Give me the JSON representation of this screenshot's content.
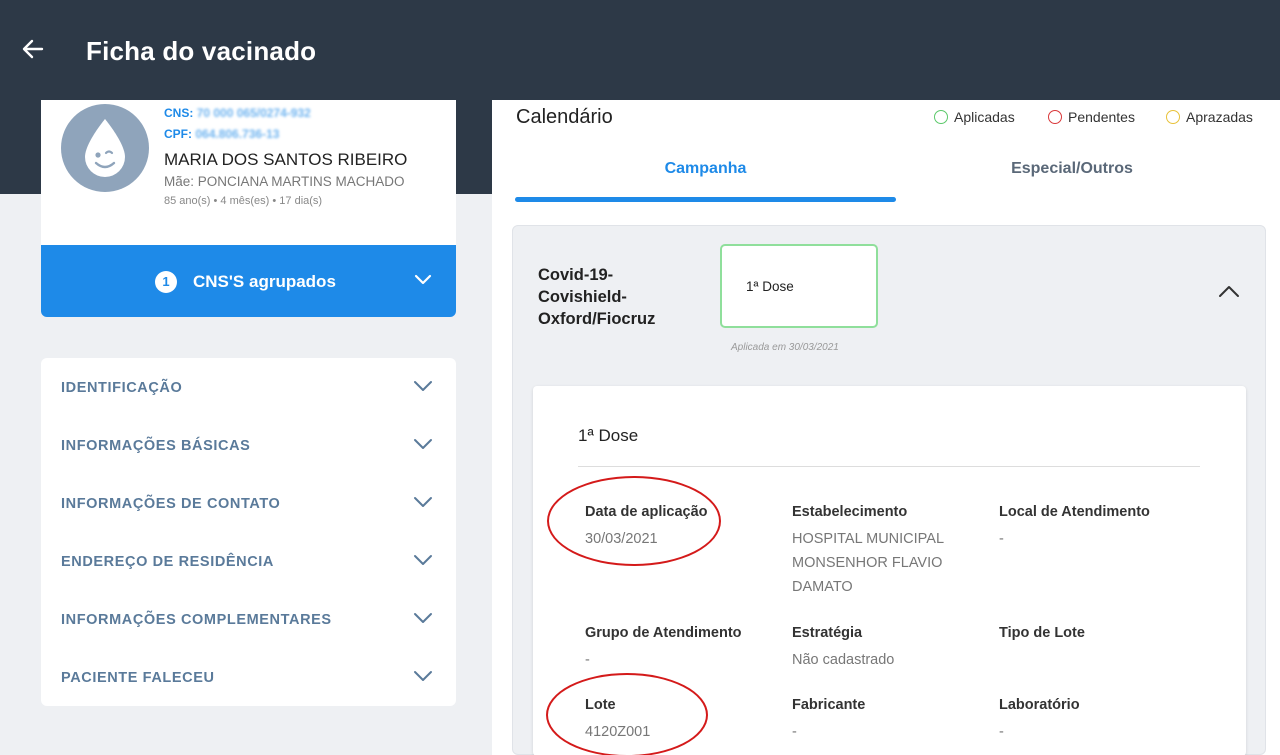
{
  "header": {
    "title": "Ficha do vacinado"
  },
  "patient": {
    "cns_label": "CNS:",
    "cns_value": "70 000 065/0274-932",
    "cpf_label": "CPF:",
    "cpf_value": "064.806.736-13",
    "name": "MARIA DOS SANTOS RIBEIRO",
    "mother": "Mãe: PONCIANA MARTINS MACHADO",
    "age": "85 ano(s) • 4 mês(es) • 17 dia(s)"
  },
  "cns_group": {
    "count": "1",
    "label": "CNS'S agrupados"
  },
  "accordion": [
    {
      "label": "IDENTIFICAÇÃO"
    },
    {
      "label": "INFORMAÇÕES BÁSICAS"
    },
    {
      "label": "INFORMAÇÕES DE CONTATO"
    },
    {
      "label": "ENDEREÇO DE RESIDÊNCIA"
    },
    {
      "label": "INFORMAÇÕES COMPLEMENTARES"
    },
    {
      "label": "PACIENTE FALECEU"
    }
  ],
  "calendar": {
    "title": "Calendário",
    "legend": [
      {
        "label": "Aplicadas",
        "color": "#5cc96b"
      },
      {
        "label": "Pendentes",
        "color": "#d9383a"
      },
      {
        "label": "Aprazadas",
        "color": "#e8c23a"
      }
    ],
    "tabs": [
      {
        "label": "Campanha"
      },
      {
        "label": "Especial/Outros"
      }
    ]
  },
  "vaccine": {
    "name": "Covid-19-Covishield-Oxford/Fiocruz",
    "dose_chip": "1ª Dose",
    "applied_note": "Aplicada em 30/03/2021"
  },
  "detail": {
    "title": "1ª Dose",
    "fields": [
      {
        "label": "Data de aplicação",
        "value": "30/03/2021"
      },
      {
        "label": "Estabelecimento",
        "value": "HOSPITAL MUNICIPAL MONSENHOR FLAVIO DAMATO"
      },
      {
        "label": "Local de Atendimento",
        "value": "-"
      },
      {
        "label": "Grupo de Atendimento",
        "value": "-"
      },
      {
        "label": "Estratégia",
        "value": "Não cadastrado"
      },
      {
        "label": "Tipo de Lote",
        "value": ""
      },
      {
        "label": "Lote",
        "value": "4120Z001"
      },
      {
        "label": "Fabricante",
        "value": "-"
      },
      {
        "label": "Laboratório",
        "value": "-"
      }
    ]
  }
}
